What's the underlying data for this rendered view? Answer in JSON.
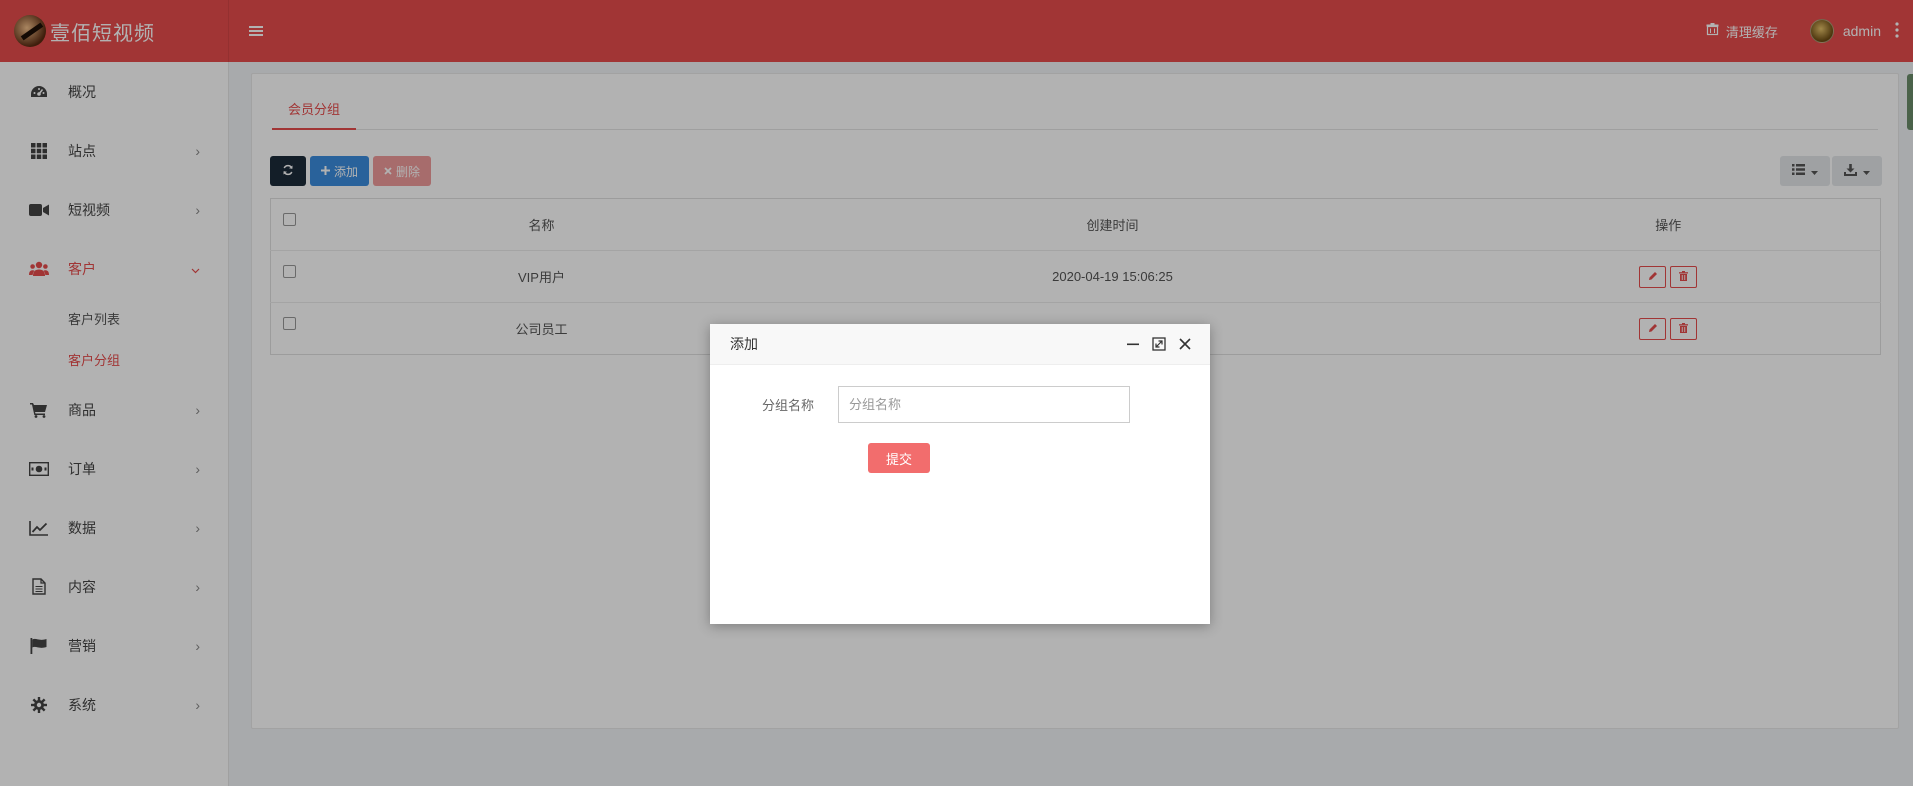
{
  "header": {
    "logo_text": "壹佰短视频",
    "clear_cache": "清理缓存",
    "username": "admin",
    "bg_color": "#e74c4c"
  },
  "sidebar": {
    "items": [
      {
        "label": "概况",
        "icon": "dashboard-icon",
        "has_arrow": false
      },
      {
        "label": "站点",
        "icon": "grid-icon",
        "has_arrow": true
      },
      {
        "label": "短视频",
        "icon": "video-camera-icon",
        "has_arrow": true
      },
      {
        "label": "客户",
        "icon": "users-icon",
        "has_arrow": true,
        "expanded": true,
        "children": [
          {
            "label": "客户列表"
          },
          {
            "label": "客户分组",
            "active": true
          }
        ]
      },
      {
        "label": "商品",
        "icon": "cart-icon",
        "has_arrow": true
      },
      {
        "label": "订单",
        "icon": "money-icon",
        "has_arrow": true
      },
      {
        "label": "数据",
        "icon": "line-chart-icon",
        "has_arrow": true
      },
      {
        "label": "内容",
        "icon": "file-icon",
        "has_arrow": true
      },
      {
        "label": "营销",
        "icon": "flag-icon",
        "has_arrow": true
      },
      {
        "label": "系统",
        "icon": "gear-icon",
        "has_arrow": true
      }
    ]
  },
  "main": {
    "tab": "会员分组",
    "toolbar": {
      "add_label": "添加",
      "delete_label": "删除"
    },
    "table": {
      "headers": [
        "名称",
        "创建时间",
        "操作"
      ],
      "rows": [
        {
          "name": "VIP用户",
          "created": "2020-04-19 15:06:25"
        },
        {
          "name": "公司员工",
          "created": ""
        }
      ]
    }
  },
  "modal": {
    "title": "添加",
    "field_label": "分组名称",
    "field_placeholder": "分组名称",
    "submit_label": "提交"
  }
}
